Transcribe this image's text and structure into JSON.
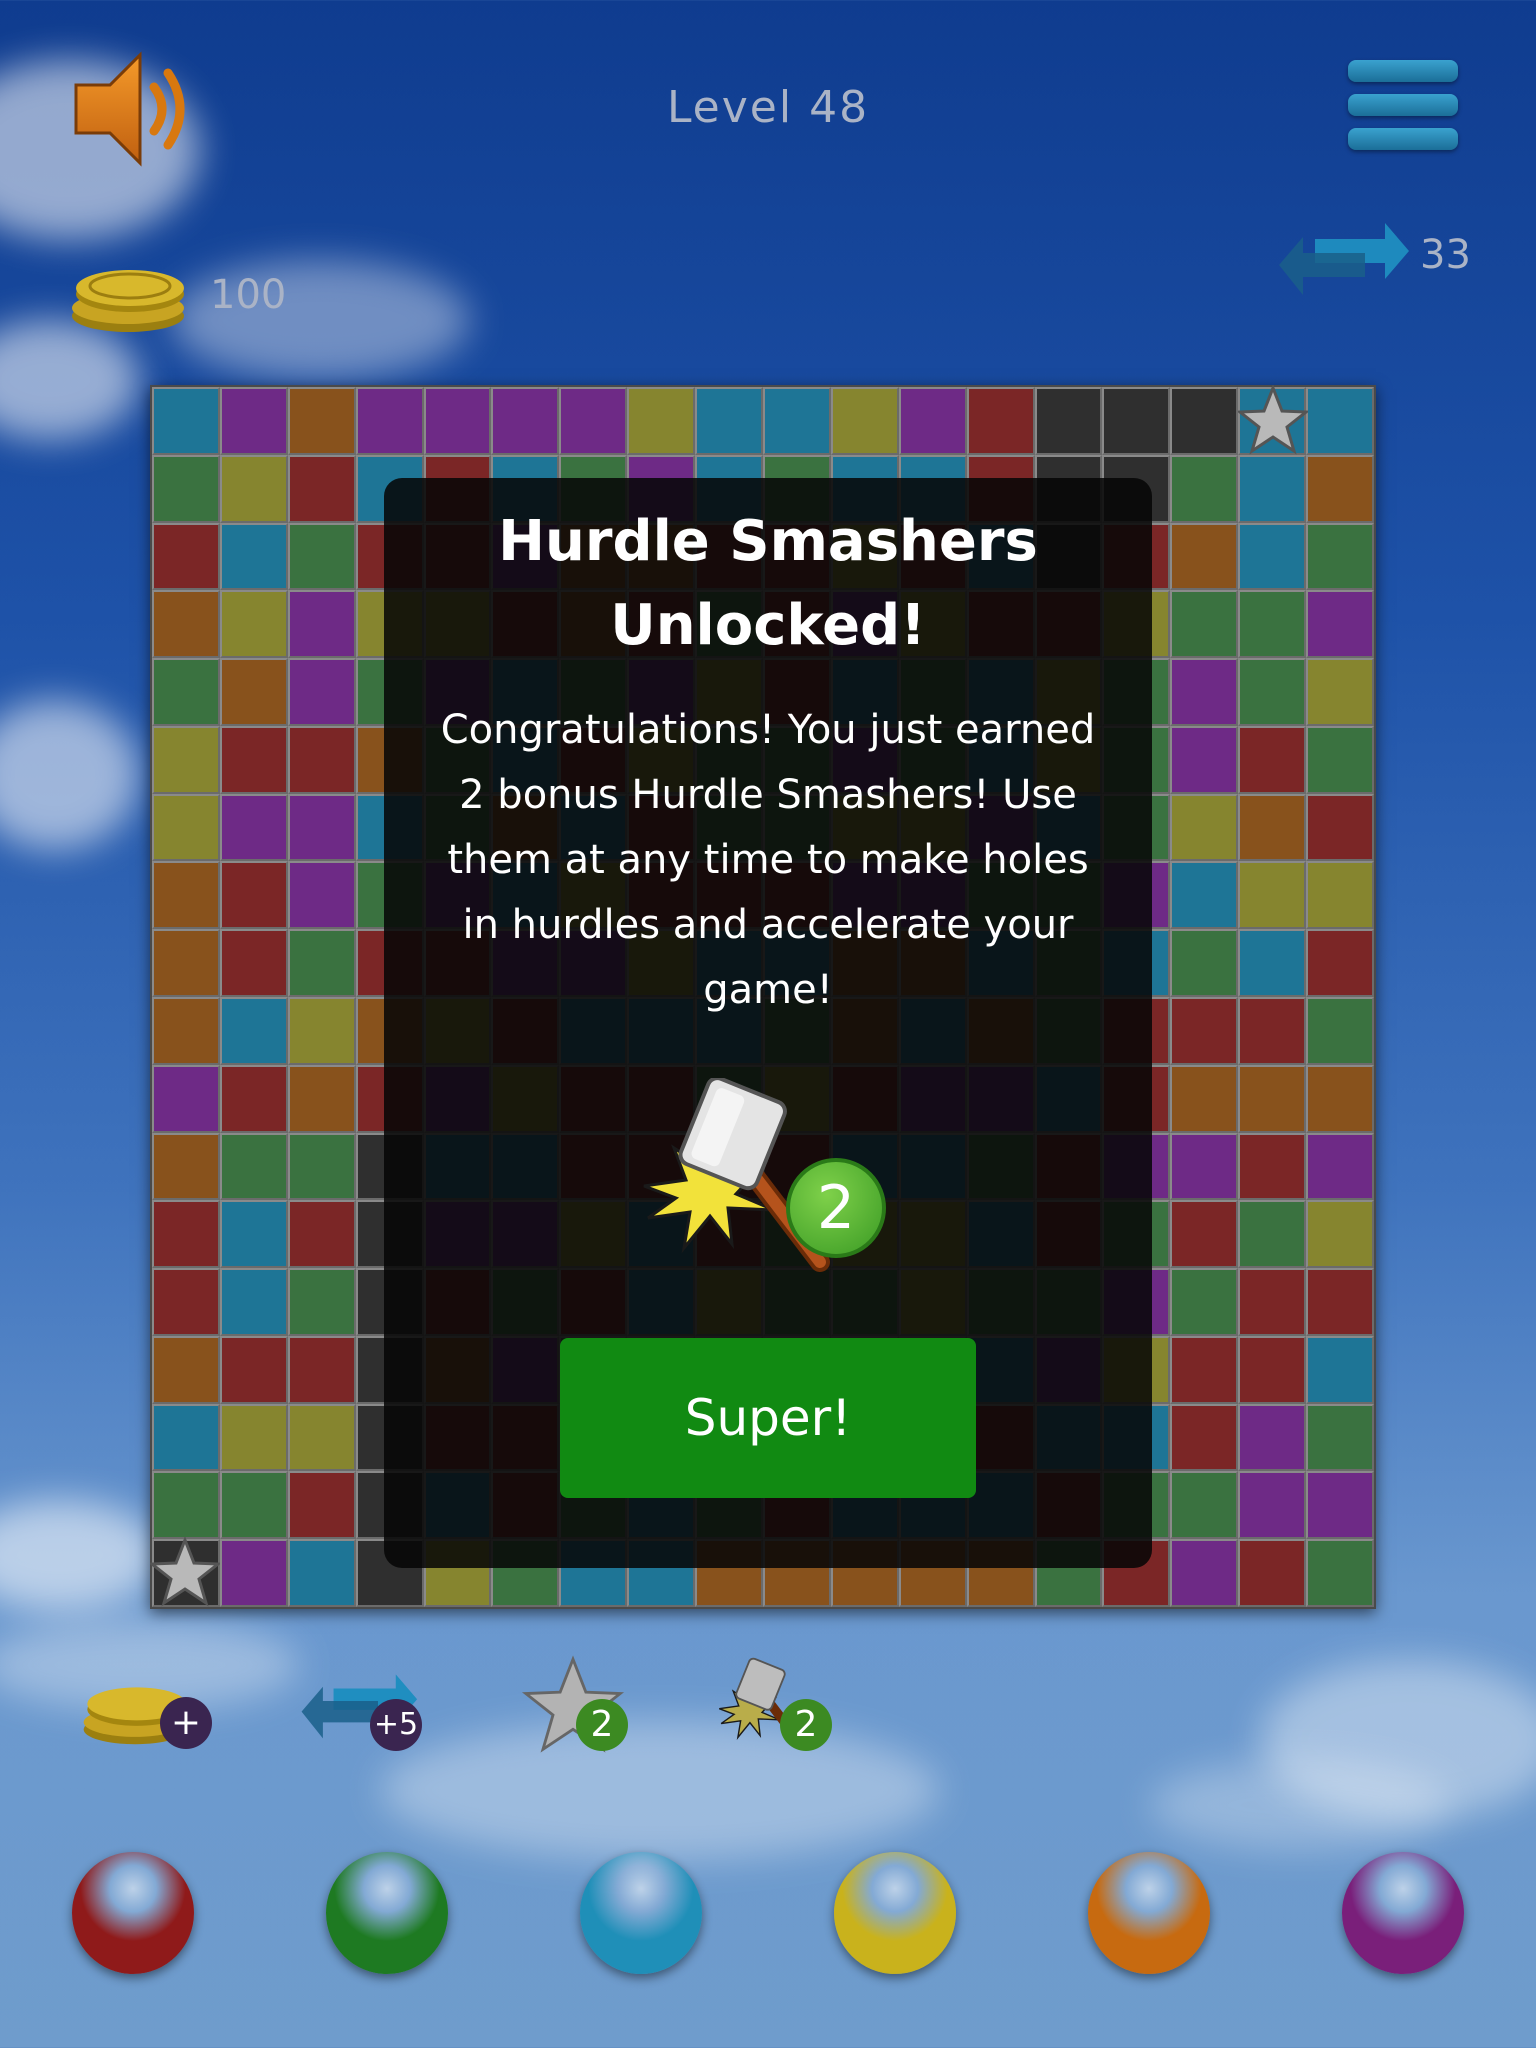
{
  "level": {
    "title": "Level 48"
  },
  "hud": {
    "coins": "100",
    "moves": "33"
  },
  "board": {
    "columns": 18,
    "rows": 18,
    "palette": {
      "b": "#1e7596",
      "p": "#6e2a86",
      "o": "#88521c",
      "y": "#86852f",
      "g": "#3a7240",
      "r": "#7b2626",
      "k": "#2f2f2f"
    },
    "cells": [
      "bpoppppybbyprkkkbb",
      "gyrbrbgpbgbbrkkgbo",
      "rbgrrpoorryrbkrobg",
      "oypyyrorgrpyrryggp",
      "gopgpbgpyrbgbygpgy",
      "yrrogbryggpgbygprg",
      "yppbgobrggyypbgyor",
      "orpgpbyrrrppggpbyy",
      "orgrrppybboobgbgbr",
      "obyoyrbbbgobogrrrg",
      "prorpyrrgyrppbrooo",
      "oggkbbrrrrbbgrpprp",
      "rbrkppybrgyybrgrgy",
      "rbgkrgrbyggyggpgrr",
      "orrkopggyyrgbpyrrb",
      "byykrrpygbygrbbrpg",
      "ggrkbrgbgrbbbrggpp",
      "kpbkygbbooooogrprg"
    ]
  },
  "dialog": {
    "title_line1": "Hurdle Smashers",
    "title_line2": "Unlocked!",
    "message": "Congratulations!  You just earned 2 bonus Hurdle Smashers!  Use them at any time to make holes in hurdles and accelerate your game!",
    "reward_count": "2",
    "confirm_label": "Super!"
  },
  "toolbar": {
    "coins_add": "+",
    "moves_add": "+5",
    "star_count": "2",
    "hammer_count": "2"
  },
  "color_balls": [
    {
      "name": "red",
      "color": "#8f1a1a"
    },
    {
      "name": "green",
      "color": "#1e7a22"
    },
    {
      "name": "blue",
      "color": "#1f8fb8"
    },
    {
      "name": "yellow",
      "color": "#c9b21c"
    },
    {
      "name": "orange",
      "color": "#c76a10"
    },
    {
      "name": "purple",
      "color": "#7a1f7a"
    }
  ],
  "icons": {
    "sound": "speaker-icon",
    "menu": "hamburger-menu-icon",
    "moves": "swap-arrows-icon",
    "coins": "coin-stack-icon",
    "star": "star-icon",
    "hammer": "hammer-icon"
  }
}
